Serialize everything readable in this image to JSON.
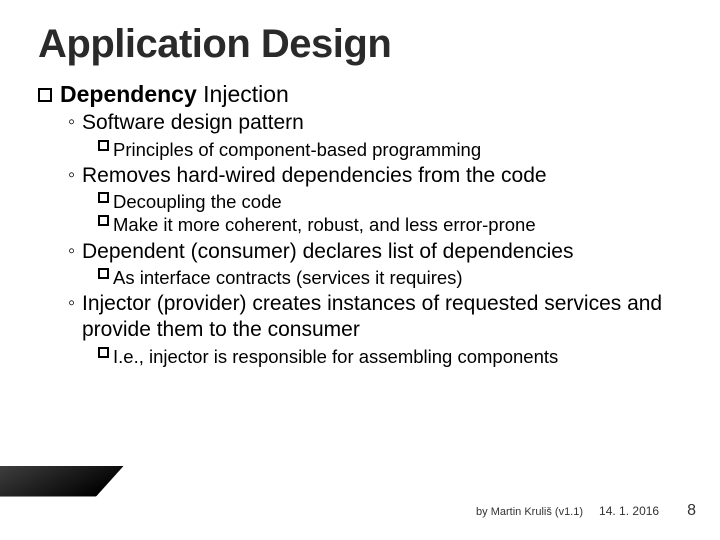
{
  "title": "Application Design",
  "l1": {
    "bold": "Dependency",
    "rest": " Injection"
  },
  "items": [
    {
      "l2": "Software design pattern",
      "l3": [
        "Principles of component-based programming"
      ]
    },
    {
      "l2": "Removes hard-wired dependencies from the code",
      "l3": [
        "Decoupling the code",
        "Make it more coherent, robust, and less error-prone"
      ]
    },
    {
      "l2": "Dependent (consumer) declares list of dependencies",
      "l3": [
        "As interface contracts (services it requires)"
      ]
    },
    {
      "l2": "Injector (provider) creates instances of requested services and provide them to the consumer",
      "l3": [
        "I.e., injector is responsible for assembling components"
      ]
    }
  ],
  "footer": {
    "by": "by Martin Kruliš (v1.1)",
    "date": "14. 1. 2016",
    "page": "8"
  }
}
